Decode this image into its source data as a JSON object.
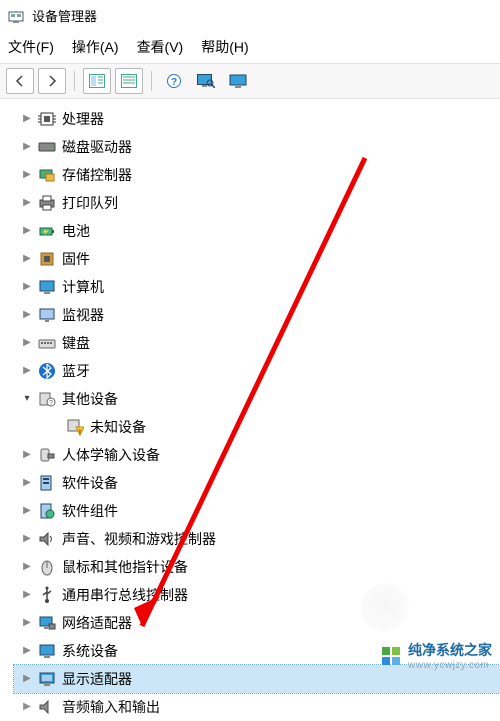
{
  "window": {
    "title": "设备管理器"
  },
  "menu": {
    "file": "文件(F)",
    "action": "操作(A)",
    "view": "查看(V)",
    "help": "帮助(H)"
  },
  "tree": {
    "items": [
      {
        "label": "处理器"
      },
      {
        "label": "磁盘驱动器"
      },
      {
        "label": "存储控制器"
      },
      {
        "label": "打印队列"
      },
      {
        "label": "电池"
      },
      {
        "label": "固件"
      },
      {
        "label": "计算机"
      },
      {
        "label": "监视器"
      },
      {
        "label": "键盘"
      },
      {
        "label": "蓝牙"
      },
      {
        "label": "其他设备",
        "expanded": true,
        "children": [
          {
            "label": "未知设备"
          }
        ]
      },
      {
        "label": "人体学输入设备"
      },
      {
        "label": "软件设备"
      },
      {
        "label": "软件组件"
      },
      {
        "label": "声音、视频和游戏控制器"
      },
      {
        "label": "鼠标和其他指针设备"
      },
      {
        "label": "通用串行总线控制器"
      },
      {
        "label": "网络适配器"
      },
      {
        "label": "系统设备"
      },
      {
        "label": "显示适配器",
        "selected": true
      },
      {
        "label": "音频输入和输出",
        "cutoff": true
      }
    ]
  },
  "watermark": {
    "text": "纯净系统之家",
    "sub": "www.ycwjzy.com"
  }
}
